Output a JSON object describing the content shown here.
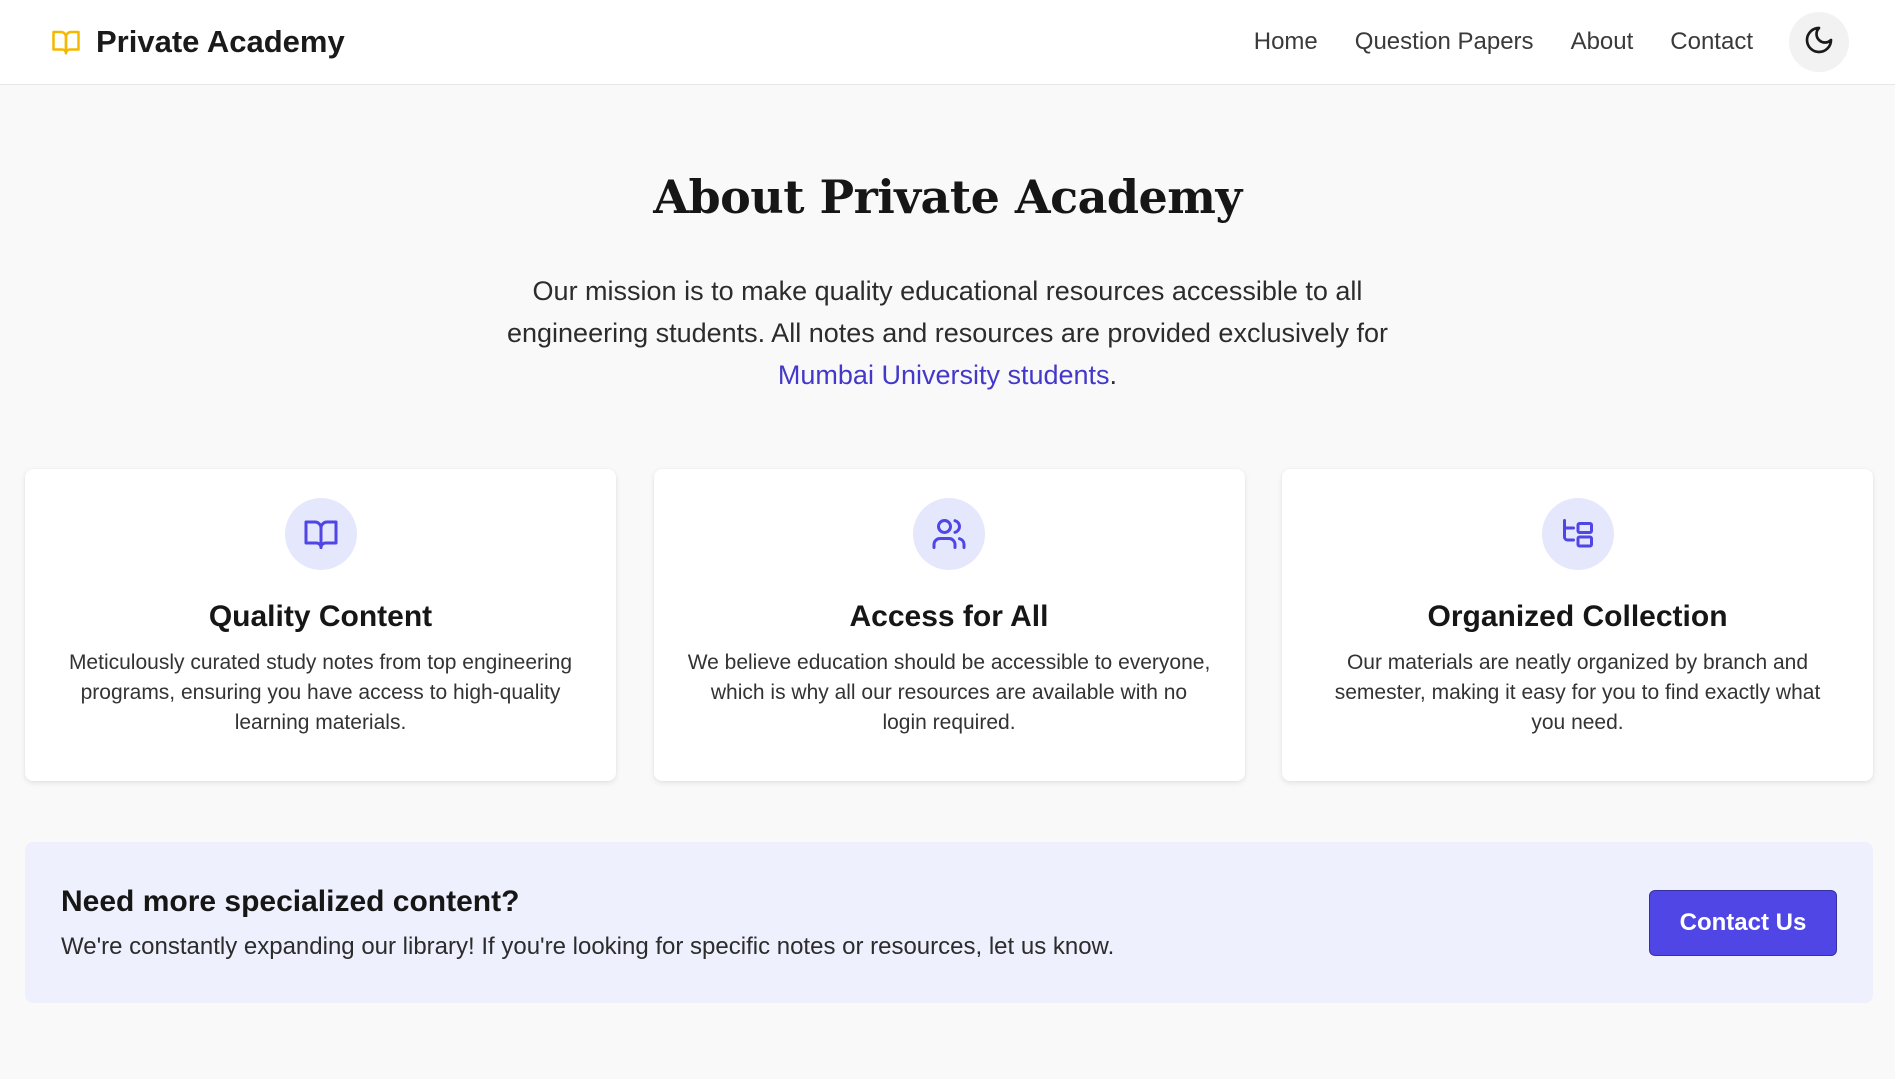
{
  "colors": {
    "accent": "#4f46e5",
    "link": "#4338ca",
    "brand_icon": "#f5b800",
    "icon_circle": "#e5e7fc",
    "cta_background": "#eef0fd"
  },
  "navbar": {
    "brand": {
      "icon": "book-open-icon",
      "name": "Private Academy"
    },
    "links": [
      {
        "label": "Home"
      },
      {
        "label": "Question Papers"
      },
      {
        "label": "About"
      },
      {
        "label": "Contact"
      }
    ],
    "theme_toggle": {
      "icon": "moon-icon"
    }
  },
  "hero": {
    "title": "About Private Academy",
    "text_before": "Our mission is to make quality educational resources accessible to all engineering students. All notes and resources are provided exclusively for ",
    "link_text": "Mumbai University students",
    "text_after": "."
  },
  "features": [
    {
      "icon": "book-open-icon",
      "title": "Quality Content",
      "text": "Meticulously curated study notes from top engineering programs, ensuring you have access to high-quality learning materials."
    },
    {
      "icon": "users-icon",
      "title": "Access for All",
      "text": "We believe education should be accessible to everyone, which is why all our resources are available with no login required."
    },
    {
      "icon": "folder-tree-icon",
      "title": "Organized Collection",
      "text": "Our materials are neatly organized by branch and semester, making it easy for you to find exactly what you need."
    }
  ],
  "cta": {
    "title": "Need more specialized content?",
    "text": "We're constantly expanding our library! If you're looking for specific notes or resources, let us know.",
    "button_label": "Contact Us"
  }
}
